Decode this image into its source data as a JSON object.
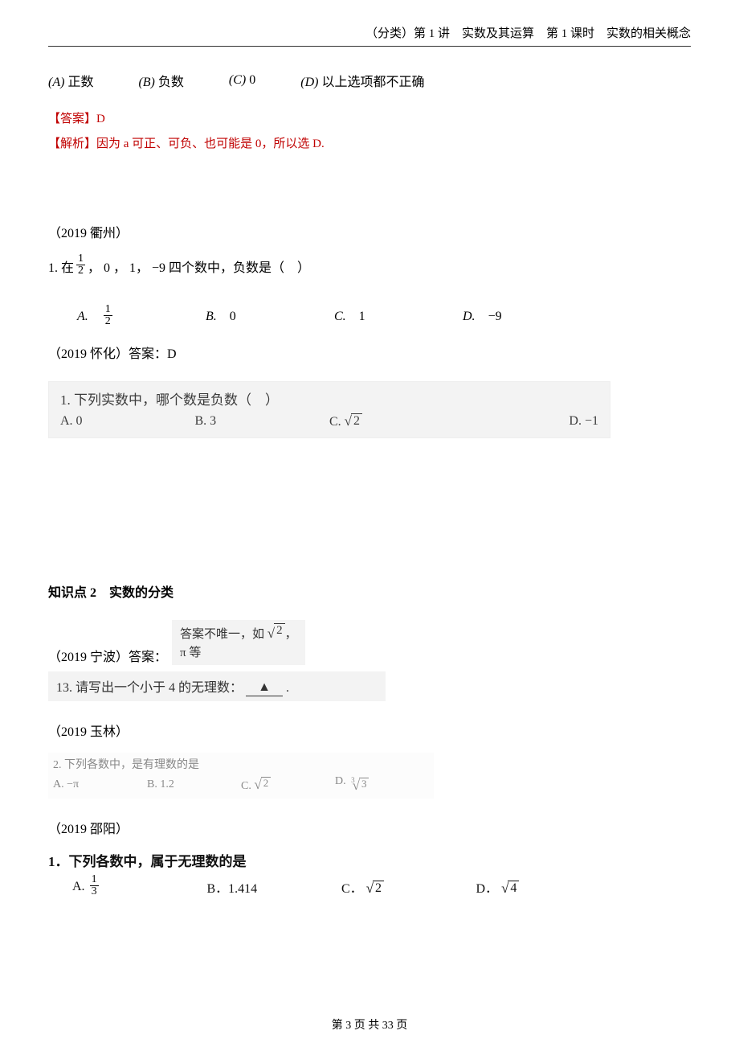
{
  "header": {
    "text": "（分类）第 1 讲　实数及其运算　第 1 课时　实数的相关概念"
  },
  "q0": {
    "optA_label": "(A)",
    "optA_text": "正数",
    "optB_label": "(B)",
    "optB_text": "负数",
    "optC_label": "(C)",
    "optC_text": "0",
    "optD_label": "(D)",
    "optD_text": "以上选项都不正确"
  },
  "ans0": {
    "title": "【答案】",
    "value": "D",
    "expl_title": "【解析】",
    "expl_text": "因为 a 可正、可负、也可能是 0，所以选 D."
  },
  "yr_quzhou": "（2019 衢州）",
  "q1": {
    "prefix": "1. 在",
    "frac_num": "1",
    "frac_den": "2",
    "mid": "， 0 ， 1， −9 四个数中，负数是（　）",
    "A_lbl": "A.",
    "A_val_num": "1",
    "A_val_den": "2",
    "B_lbl": "B.",
    "B_val": "0",
    "C_lbl": "C.",
    "C_val": "1",
    "D_lbl": "D.",
    "D_val": "−9"
  },
  "ans_huaihua": "（2019 怀化）答案：D",
  "scanA": {
    "q": "1. 下列实数中，哪个数是负数（　）",
    "A": "A. 0",
    "B": "B. 3",
    "C": "C.",
    "C_rad": "2",
    "D": "D. −1"
  },
  "section2": "知识点 2　实数的分类",
  "ningbo": {
    "label": "（2019 宁波）答案：",
    "line1": "答案不唯一，如",
    "rad": "2",
    "tail": "，",
    "line2": "π 等"
  },
  "scanB": {
    "text_pre": "13. 请写出一个小于 4 的无理数：",
    "blank": "▲",
    "tail": "."
  },
  "yr_yulin": "（2019 玉林）",
  "scanC": {
    "q": "2. 下列各数中，是有理数的是",
    "A": "A. −π",
    "B": "B. 1.2",
    "C": "C.",
    "C_rad": "2",
    "D": "D.",
    "D_rad": "3"
  },
  "yr_shaoyang": "（2019 邵阳）",
  "scanD": {
    "q": "1．下列各数中，属于无理数的是",
    "A": "A.",
    "A_num": "1",
    "A_den": "3",
    "B": "B．1.414",
    "C": "C．",
    "C_rad": "2",
    "D": "D．",
    "D_rad": "4"
  },
  "footer": "第 3 页 共 33 页"
}
